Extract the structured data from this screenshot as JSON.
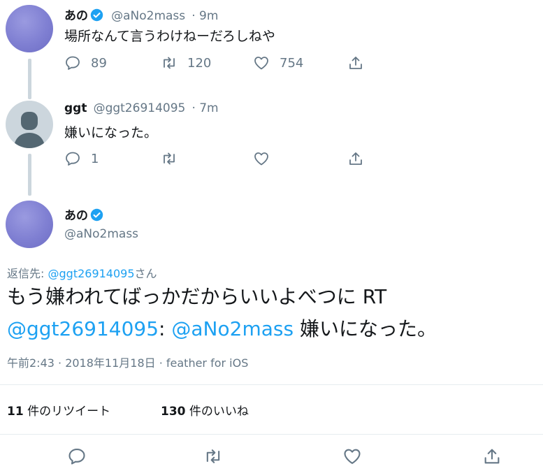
{
  "colors": {
    "accent": "#1da1f2",
    "muted": "#657786",
    "text": "#14171a",
    "divider": "#e6ecf0",
    "avatar": "#7f7fd2"
  },
  "tweet1": {
    "name": "あの",
    "handle": "@aNo2mass",
    "time": "· 9m",
    "text": "場所なんて言うわけねーだろしねや",
    "replies": "89",
    "retweets": "120",
    "likes": "754"
  },
  "tweet2": {
    "name": "ggt",
    "handle": "@ggt26914095",
    "time": "· 7m",
    "text": "嫌いになった。",
    "replies": "1"
  },
  "main": {
    "name": "あの",
    "handle": "@aNo2mass",
    "reply_label": "返信先:",
    "reply_to": "@ggt26914095",
    "reply_suffix": "さん",
    "text_line1": "もう嫌われてばっかだからいいよべつに RT",
    "mention1": "@ggt26914095",
    "colon": ":",
    "mention2": "@aNo2mass",
    "text_tail": "嫌いになった。",
    "meta": "午前2:43 · 2018年11月18日 · feather for iOS",
    "retweet_count": "11",
    "retweet_label": "件のリツイート",
    "like_count": "130",
    "like_label": "件のいいね"
  },
  "icons": [
    "verified-icon",
    "reply-icon",
    "retweet-icon",
    "like-icon",
    "share-icon",
    "default-avatar-icon"
  ]
}
